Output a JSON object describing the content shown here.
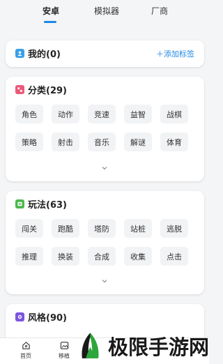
{
  "tabs": [
    {
      "label": "安卓",
      "active": true
    },
    {
      "label": "模拟器",
      "active": false
    },
    {
      "label": "厂商",
      "active": false
    }
  ],
  "my": {
    "title": "我的(0)",
    "add_label": "添加标签"
  },
  "category": {
    "title": "分类(29)",
    "tags": [
      "角色",
      "动作",
      "竞速",
      "益智",
      "战棋",
      "策略",
      "射击",
      "音乐",
      "解谜",
      "体育"
    ]
  },
  "gameplay": {
    "title": "玩法(63)",
    "tags": [
      "闯关",
      "跑酷",
      "塔防",
      "站桩",
      "逃脱",
      "推理",
      "换装",
      "合成",
      "收集",
      "点击"
    ]
  },
  "style": {
    "title": "风格(90)"
  },
  "bottom_nav": [
    {
      "label": "首页",
      "icon": "home-icon"
    },
    {
      "label": "移植",
      "icon": "image-icon"
    }
  ],
  "watermark": {
    "text": "极限手游网"
  },
  "colors": {
    "accent": "#1e88e5",
    "my_icon": "#3aa0e8",
    "category_icon": "#ea5b7a",
    "gameplay_icon": "#4cb84c",
    "style_icon": "#7b55e0"
  }
}
